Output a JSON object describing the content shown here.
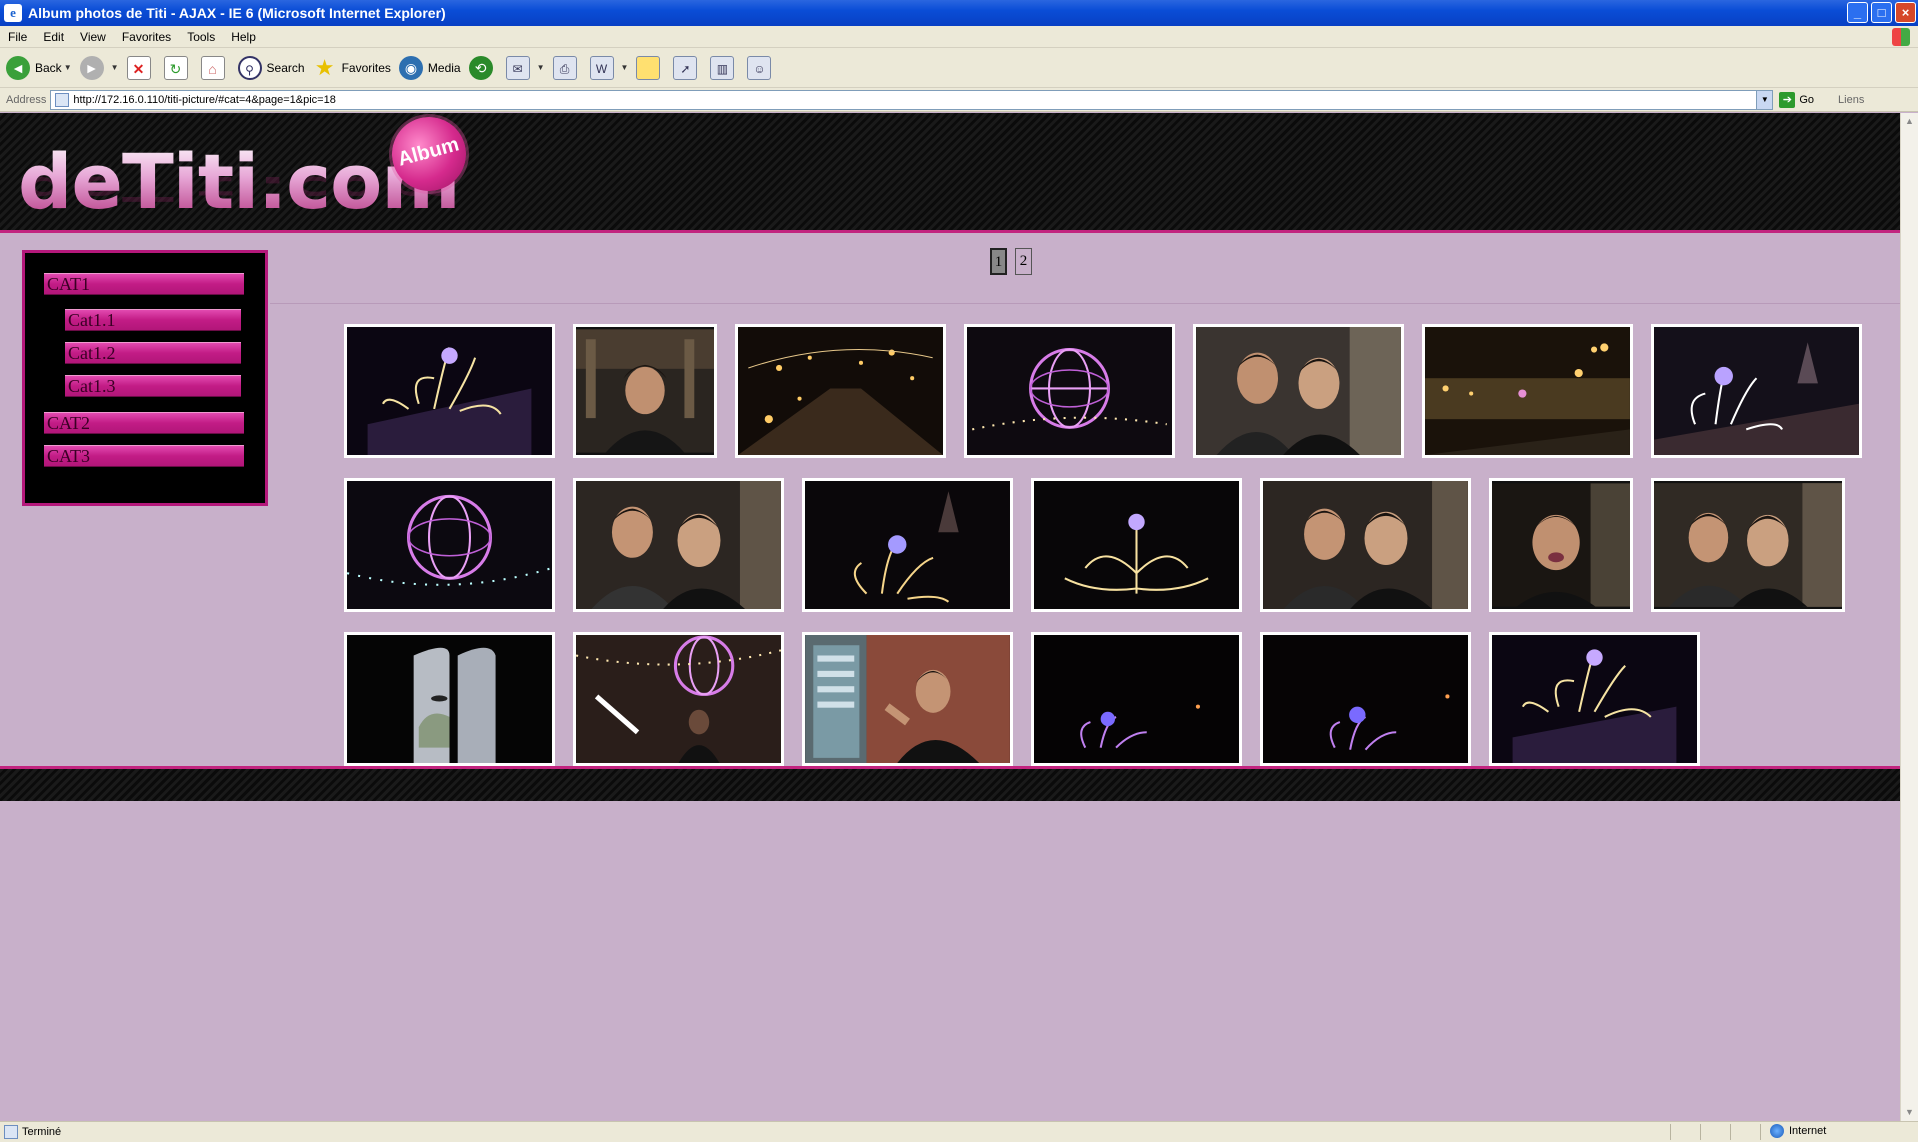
{
  "window": {
    "title": "Album photos de Titi - AJAX - IE 6 (Microsoft Internet Explorer)",
    "minimize": "_",
    "maximize": "□",
    "close": "×"
  },
  "menu": [
    "File",
    "Edit",
    "View",
    "Favorites",
    "Tools",
    "Help"
  ],
  "toolbar": {
    "back_label": "Back",
    "search_label": "Search",
    "favorites_label": "Favorites",
    "media_label": "Media"
  },
  "address": {
    "label": "Address",
    "url": "http://172.16.0.110/titi-picture/#cat=4&page=1&pic=18",
    "go_label": "Go",
    "links_label": "Liens"
  },
  "site": {
    "logo_text": "deTiti.com",
    "badge_text": "Album"
  },
  "sidebar": {
    "cat1": "CAT1",
    "cat1_1": "Cat1.1",
    "cat1_2": "Cat1.2",
    "cat1_3": "Cat1.3",
    "cat2": "CAT2",
    "cat3": "CAT3"
  },
  "pager": {
    "page1": "1",
    "page2": "2",
    "current": "1"
  },
  "status": {
    "text": "Terminé",
    "zone": "Internet"
  },
  "colors": {
    "page_bg": "#c8b0ca",
    "accent": "#c2247f",
    "header_bg": "#111111"
  }
}
